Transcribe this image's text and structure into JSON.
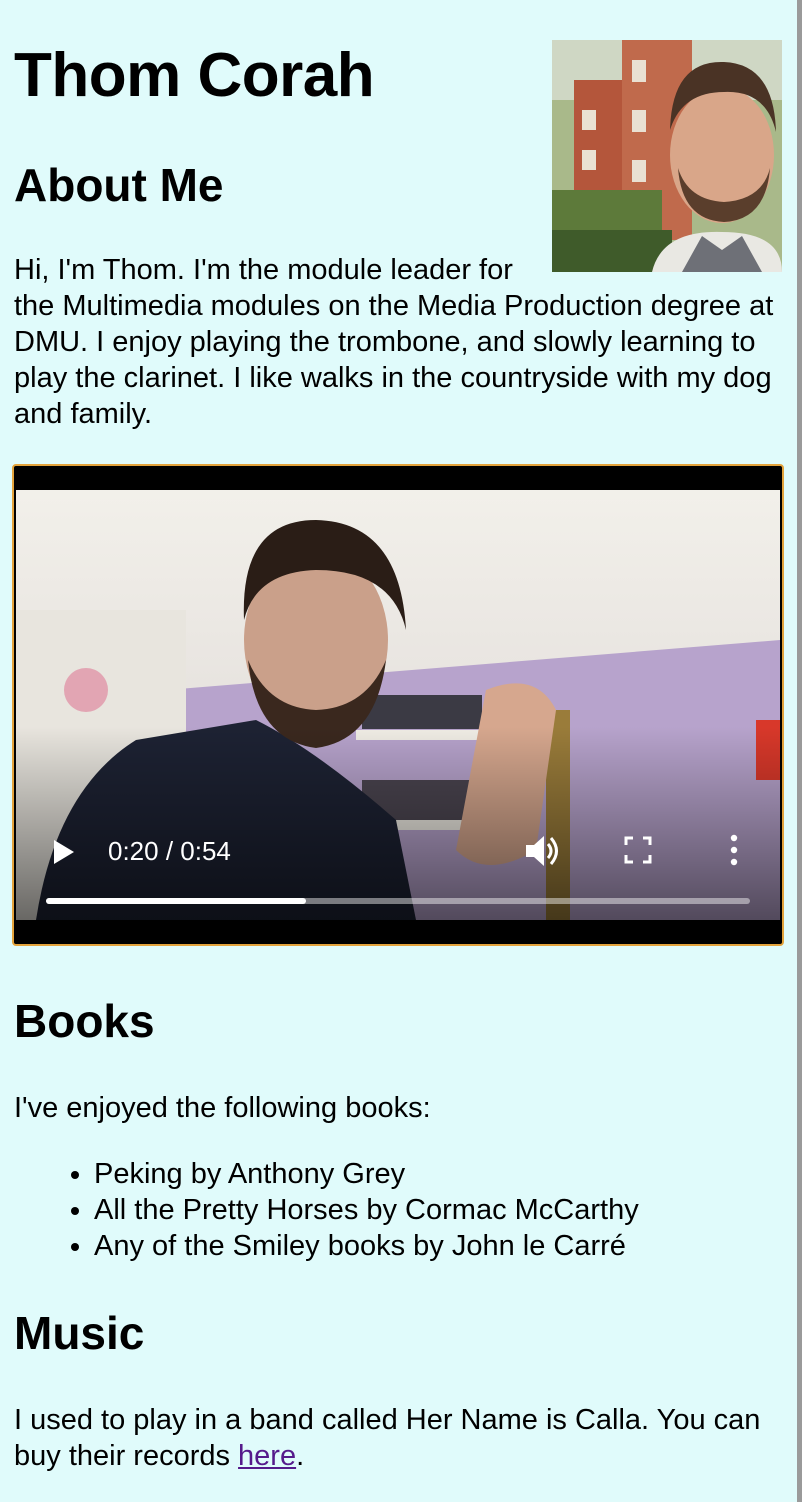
{
  "header": {
    "name": "Thom Corah"
  },
  "about": {
    "heading": "About Me",
    "text": "Hi, I'm Thom. I'm the module leader for the Multimedia modules on the Media Production degree at DMU. I enjoy playing the trombone, and slowly learning to play the clarinet. I like walks in the countryside with my dog and family."
  },
  "video": {
    "time": "0:20 / 0:54",
    "progress_fraction": 0.37,
    "icons": {
      "play": "play-icon",
      "volume": "volume-icon",
      "fullscreen": "fullscreen-icon",
      "more": "more-vertical-icon"
    },
    "border_color": "#e3a33c"
  },
  "books": {
    "heading": "Books",
    "intro": "I've enjoyed the following books:",
    "items": [
      "Peking by Anthony Grey",
      "All the Pretty Horses by Cormac McCarthy",
      "Any of the Smiley books by John le Carré"
    ]
  },
  "music": {
    "heading": "Music",
    "text_before": "I used to play in a band called Her Name is Calla. You can buy their records ",
    "link_label": "here",
    "text_after": "."
  },
  "colors": {
    "background": "#e0fbfb",
    "link": "#551a8b"
  }
}
